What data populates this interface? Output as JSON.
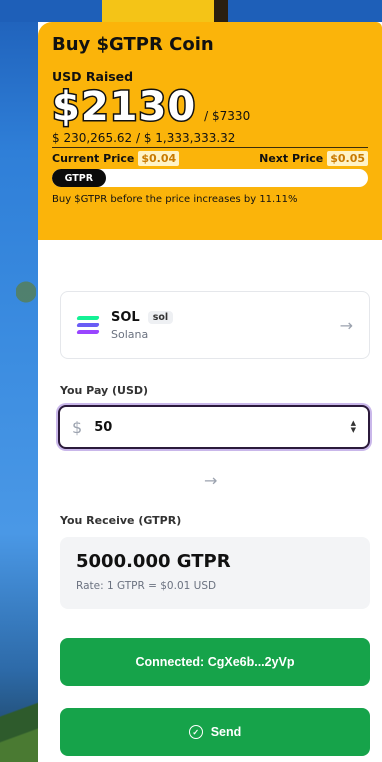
{
  "presale": {
    "title": "Buy $GTPR Coin",
    "usd_label": "USD Raised",
    "big_amount": "$2130",
    "goal": "/ $7330",
    "raised_line": "$ 230,265.62 / $ 1,333,333.32",
    "current_price_label": "Current Price",
    "current_price": "$0.04",
    "next_price_label": "Next Price",
    "next_price": "$0.05",
    "progress_label": "GTPR",
    "progress_fraction": 0.17,
    "note": "Buy $GTPR before the price increases by 11.11%"
  },
  "token": {
    "name": "SOL",
    "tag": "sol",
    "network": "Solana",
    "icon": "solana-icon",
    "arrow": "→"
  },
  "pay": {
    "label": "You Pay (USD)",
    "currency_symbol": "$",
    "value": "50"
  },
  "swap_arrow": "→",
  "receive": {
    "label": "You Receive (GTPR)",
    "amount": "5000.000 GTPR",
    "rate": "Rate: 1 GTPR = $0.01 USD"
  },
  "buttons": {
    "connected": "Connected: CgXe6b...2yVp",
    "send": "Send"
  },
  "colors": {
    "accent": "#fbb40a",
    "button": "#16a34a",
    "input_border": "#2b1a3b",
    "solana_1": "#14f195",
    "solana_2": "#6a5cf5",
    "solana_3": "#9945ff"
  }
}
